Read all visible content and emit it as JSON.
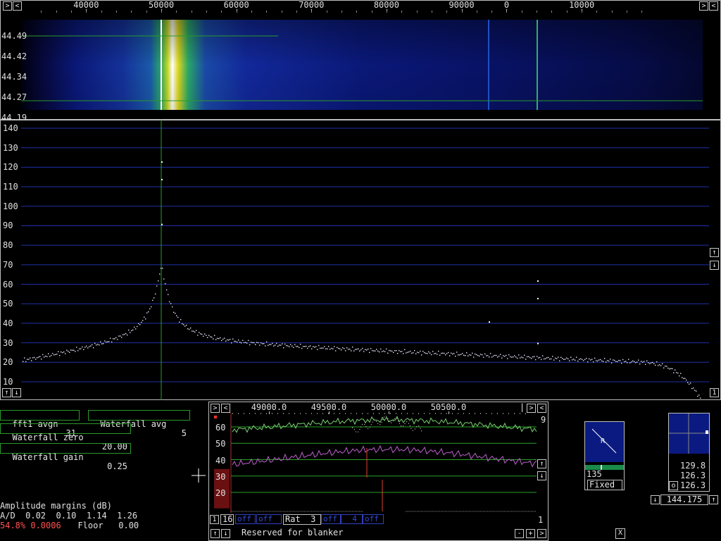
{
  "freq_scale": {
    "ticks": [
      {
        "value": 40000,
        "label": "40000"
      },
      {
        "value": 50000,
        "label": "50000"
      },
      {
        "value": 60000,
        "label": "60000"
      },
      {
        "value": 70000,
        "label": "70000"
      },
      {
        "value": 80000,
        "label": "80000"
      },
      {
        "value": 90000,
        "label": "90000"
      },
      {
        "value": 96000,
        "label": "0"
      },
      {
        "value": 106000,
        "label": "10000"
      }
    ],
    "left_arrow": "<",
    "right_arrow_a": ">",
    "right_arrow_b": "<"
  },
  "waterfall": {
    "time_labels": [
      "44.49",
      "44.42",
      "44.34",
      "44.27",
      "44.19"
    ],
    "peak_freq": 50000
  },
  "spectrum": {
    "y_labels": [
      "140",
      "130",
      "120",
      "110",
      "100",
      "90",
      "80",
      "70",
      "60",
      "50",
      "40",
      "30",
      "20",
      "10"
    ],
    "up_arrow": "↑",
    "down_arrow": "↓",
    "corner_right": "1",
    "corner_left_up": "↑",
    "corner_left_down": "↓"
  },
  "params": {
    "fft1_avgn_label": "fft1 avgn",
    "fft1_avgn_value": "31",
    "waterfall_avg_label": "Waterfall avg",
    "waterfall_avg_value": "5",
    "waterfall_zero_label": "Waterfall zero",
    "waterfall_zero_value": "20.00",
    "waterfall_gain_label": "Waterfall gain",
    "waterfall_gain_value": "0.25"
  },
  "margins": {
    "title": "Amplitude margins (dB)",
    "ad_line": "A/D  0.02  0.10  1.14  1.26",
    "status_red": "54.8% 0.0006",
    "floor_line": "  Floor   0.00"
  },
  "baseband": {
    "freq_labels": [
      "49000.0",
      "49500.0",
      "50000.0",
      "50500.0"
    ],
    "freq_marker": "|",
    "top_right_number": "9",
    "y_labels": [
      "60",
      "50",
      "40",
      "30",
      "20"
    ],
    "controls": [
      {
        "text": "1"
      },
      {
        "text": "16"
      },
      {
        "text": "off"
      },
      {
        "text": "off"
      },
      {
        "text": "Rat  3"
      },
      {
        "text": "off"
      },
      {
        "text": "  4"
      },
      {
        "text": "off"
      }
    ],
    "right_number": "1",
    "reserved_text": "Reserved for blanker",
    "minus": "-",
    "plus": "+",
    "right_arrow": ">"
  },
  "s_meter": {
    "value": "135",
    "mode": "Fixed",
    "label": "R"
  },
  "pointer_panel": {
    "values": [
      "129.8",
      "126.3",
      "126.3"
    ],
    "o_label": "o",
    "freq": "144.175",
    "down": "↓",
    "up": "↑"
  },
  "close_button": "X",
  "colors": {
    "grid_blue": "#2030a8",
    "green_line": "#2aa02a",
    "spectrum_dots": "#e8e8ff",
    "red_text": "#ff5050"
  }
}
